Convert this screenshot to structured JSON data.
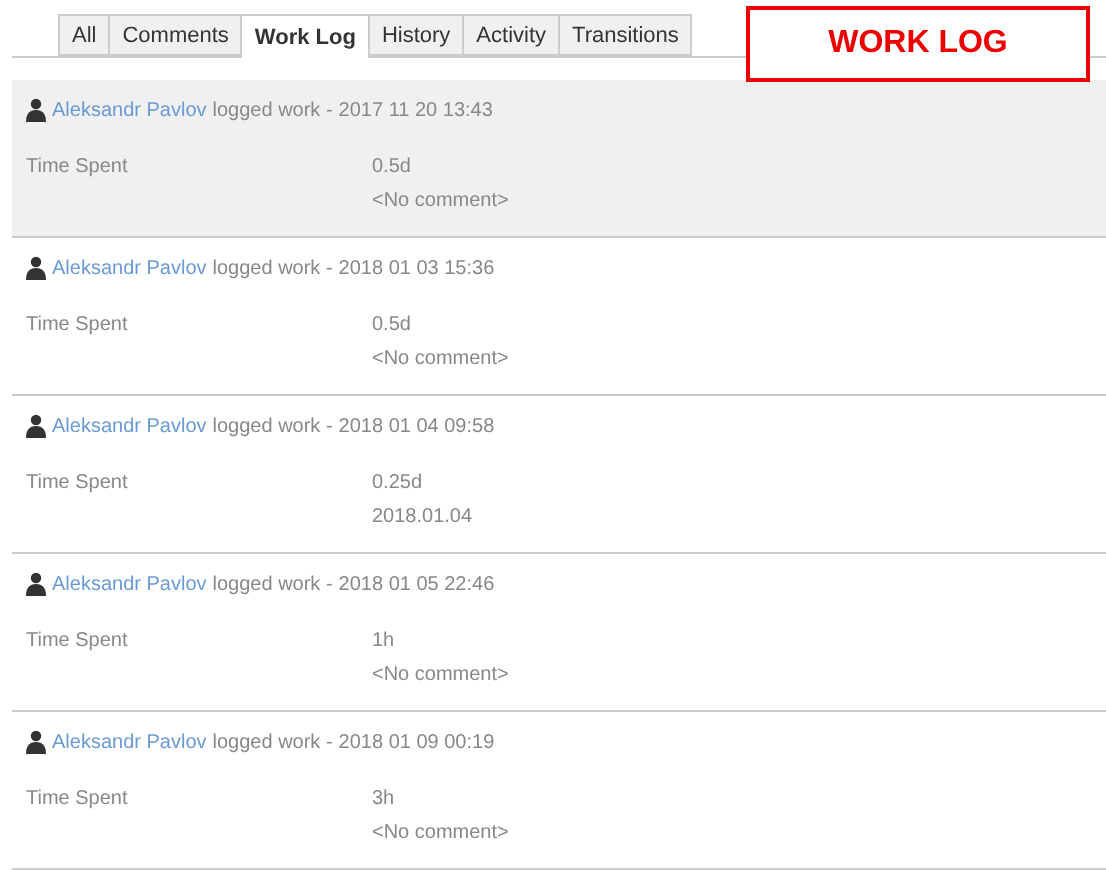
{
  "tabs": [
    {
      "label": "All",
      "selected": false
    },
    {
      "label": "Comments",
      "selected": false
    },
    {
      "label": "Work Log",
      "selected": true
    },
    {
      "label": "History",
      "selected": false
    },
    {
      "label": "Activity",
      "selected": false
    },
    {
      "label": "Transitions",
      "selected": false
    }
  ],
  "annotation": "WORK LOG",
  "worklogs": [
    {
      "author": "Aleksandr Pavlov",
      "action": "logged work -",
      "date": "2017 11 20 13:43",
      "field": "Time Spent",
      "value": "0.5d",
      "comment": "<No comment>",
      "highlighted": true
    },
    {
      "author": "Aleksandr Pavlov",
      "action": "logged work -",
      "date": "2018 01 03 15:36",
      "field": "Time Spent",
      "value": "0.5d",
      "comment": "<No comment>",
      "highlighted": false
    },
    {
      "author": "Aleksandr Pavlov",
      "action": "logged work -",
      "date": "2018 01 04 09:58",
      "field": "Time Spent",
      "value": "0.25d",
      "comment": "2018.01.04",
      "highlighted": false
    },
    {
      "author": "Aleksandr Pavlov",
      "action": "logged work -",
      "date": "2018 01 05 22:46",
      "field": "Time Spent",
      "value": "1h",
      "comment": "<No comment>",
      "highlighted": false
    },
    {
      "author": "Aleksandr Pavlov",
      "action": "logged work -",
      "date": "2018 01 09 00:19",
      "field": "Time Spent",
      "value": "3h",
      "comment": "<No comment>",
      "highlighted": false
    }
  ]
}
